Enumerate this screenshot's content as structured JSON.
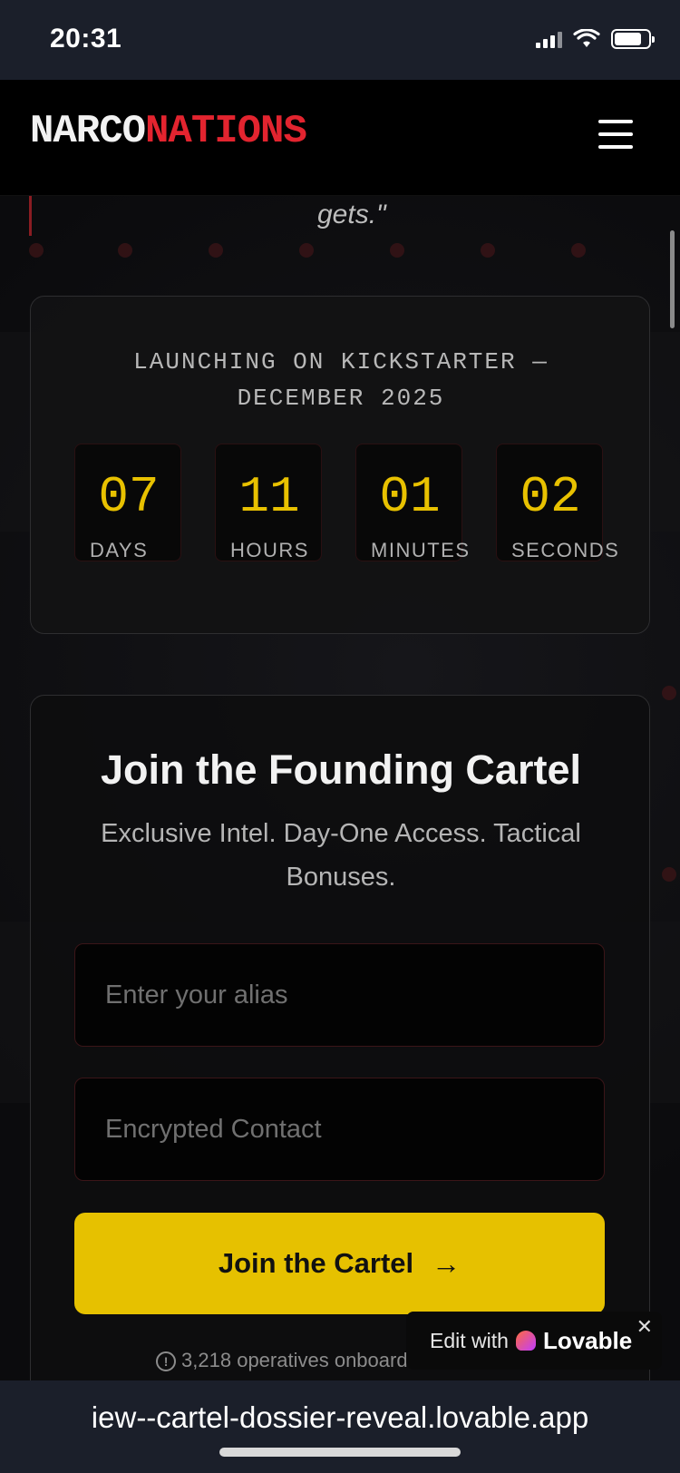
{
  "status_bar": {
    "time": "20:31"
  },
  "header": {
    "logo_part1": "NARCO",
    "logo_part2": "NATIONS"
  },
  "quote_tail": "gets.\"",
  "countdown": {
    "launch_text": "LAUNCHING ON KICKSTARTER — DECEMBER 2025",
    "units": [
      {
        "value": "07",
        "label": "DAYS"
      },
      {
        "value": "11",
        "label": "HOURS"
      },
      {
        "value": "01",
        "label": "MINUTES"
      },
      {
        "value": "02",
        "label": "SECONDS"
      }
    ]
  },
  "signup": {
    "title": "Join the Founding Cartel",
    "subtitle": "Exclusive Intel. Day-One Access. Tactical Bonuses.",
    "alias_placeholder": "Enter your alias",
    "contact_placeholder": "Encrypted Contact",
    "cta_label": "Join the Cartel",
    "footnote": "3,218 operatives onboard. La… first."
  },
  "lovable_badge": {
    "prefix": "Edit with",
    "brand": "Lovable"
  },
  "url_bar": {
    "url": "iew--cartel-dossier-reveal.lovable.app"
  },
  "colors": {
    "accent_red": "#e3242f",
    "accent_yellow": "#e6c100",
    "bg": "#0d0d0f"
  },
  "icons": [
    "signal-icon",
    "wifi-icon",
    "battery-icon",
    "menu-icon",
    "arrow-right-icon",
    "info-icon",
    "heart-icon",
    "close-icon"
  ]
}
